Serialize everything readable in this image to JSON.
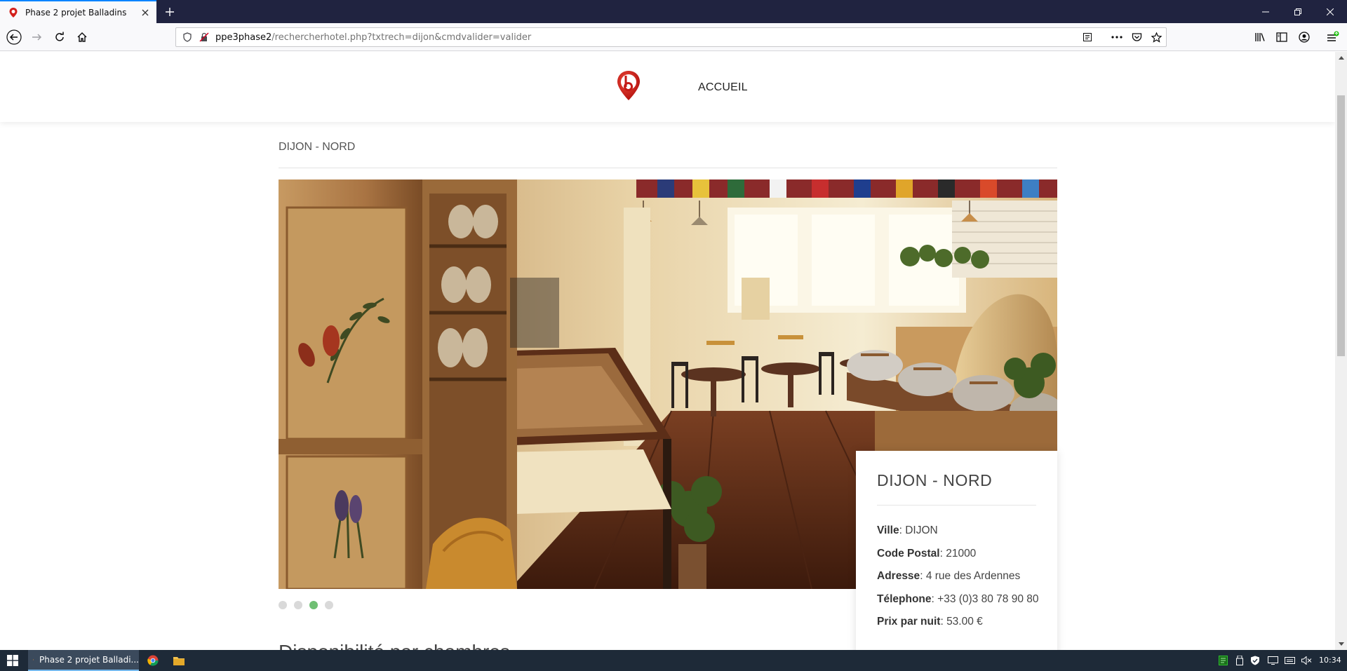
{
  "browser": {
    "tab_title": "Phase 2 projet Balladins",
    "url_host": "ppe3phase2",
    "url_path": "/rechercherhotel.php?txtrech=dijon&cmdvalider=valider"
  },
  "site": {
    "nav_home": "ACCUEIL",
    "hotel_heading": "DIJON - NORD",
    "slider": {
      "dot_count": 4,
      "active_dot": 3
    },
    "info": {
      "title": "DIJON - NORD",
      "rows": [
        {
          "label": "Ville",
          "value": "DIJON"
        },
        {
          "label": "Code Postal",
          "value": "21000"
        },
        {
          "label": "Adresse",
          "value": "4 rue des Ardennes"
        },
        {
          "label": "Télephone",
          "value": "+33 (0)3 80 78 90 80"
        },
        {
          "label": "Prix par nuit",
          "value": "53.00 €"
        }
      ]
    },
    "next_heading": "Disponibilité par chambres"
  },
  "taskbar": {
    "firefox_label": "Phase 2 projet Balladi...",
    "clock": "10:34"
  },
  "colors": {
    "accent_blue": "#0a84ff",
    "logo_red": "#d4201c",
    "dot_active": "#6fbf73",
    "taskbar": "#1e2a38",
    "titlebar": "#202340"
  }
}
